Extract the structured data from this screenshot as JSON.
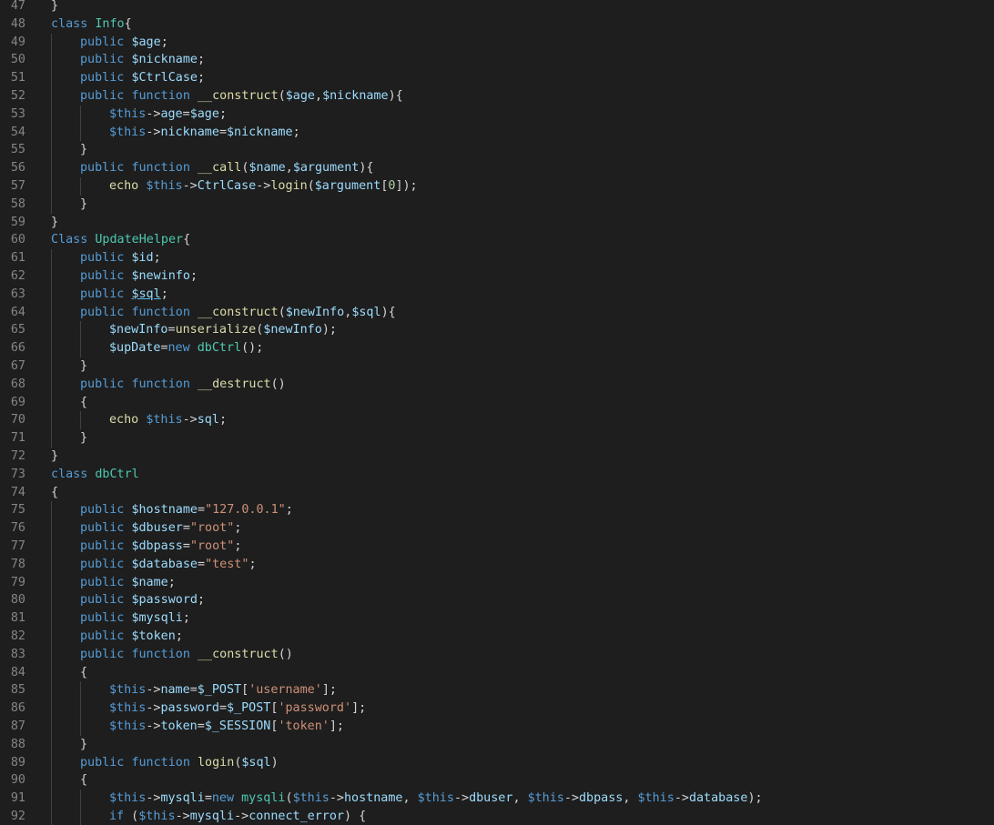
{
  "editor": {
    "theme_colors": {
      "background": "#1e1e1e",
      "line_number": "#858585",
      "keyword": "#569cd6",
      "variable": "#9cdcfe",
      "function": "#dcdcaa",
      "class": "#4ec9b0",
      "string": "#ce9178",
      "number": "#b5cea8",
      "text": "#d4d4d4"
    },
    "lines": [
      {
        "n": "47",
        "i": 0,
        "t": [
          [
            "}",
            "pn"
          ]
        ]
      },
      {
        "n": "48",
        "i": 0,
        "t": [
          [
            "class",
            "kw"
          ],
          [
            " ",
            "pn"
          ],
          [
            "Info",
            "cls"
          ],
          [
            "{",
            "pn"
          ]
        ]
      },
      {
        "n": "49",
        "i": 1,
        "t": [
          [
            "public",
            "kw"
          ],
          [
            " ",
            "pn"
          ],
          [
            "$age",
            "var"
          ],
          [
            ";",
            "pn"
          ]
        ]
      },
      {
        "n": "50",
        "i": 1,
        "t": [
          [
            "public",
            "kw"
          ],
          [
            " ",
            "pn"
          ],
          [
            "$nickname",
            "var"
          ],
          [
            ";",
            "pn"
          ]
        ]
      },
      {
        "n": "51",
        "i": 1,
        "t": [
          [
            "public",
            "kw"
          ],
          [
            " ",
            "pn"
          ],
          [
            "$CtrlCase",
            "var"
          ],
          [
            ";",
            "pn"
          ]
        ]
      },
      {
        "n": "52",
        "i": 1,
        "t": [
          [
            "public",
            "kw"
          ],
          [
            " ",
            "pn"
          ],
          [
            "function",
            "kw"
          ],
          [
            " ",
            "pn"
          ],
          [
            "__construct",
            "fn"
          ],
          [
            "(",
            "pn"
          ],
          [
            "$age",
            "var"
          ],
          [
            ",",
            "pn"
          ],
          [
            "$nickname",
            "var"
          ],
          [
            "){",
            "pn"
          ]
        ]
      },
      {
        "n": "53",
        "i": 2,
        "t": [
          [
            "$this",
            "this"
          ],
          [
            "->",
            "op"
          ],
          [
            "age",
            "var"
          ],
          [
            "=",
            "op"
          ],
          [
            "$age",
            "var"
          ],
          [
            ";",
            "pn"
          ]
        ]
      },
      {
        "n": "54",
        "i": 2,
        "t": [
          [
            "$this",
            "this"
          ],
          [
            "->",
            "op"
          ],
          [
            "nickname",
            "var"
          ],
          [
            "=",
            "op"
          ],
          [
            "$nickname",
            "var"
          ],
          [
            ";",
            "pn"
          ]
        ]
      },
      {
        "n": "55",
        "i": 1,
        "t": [
          [
            "}",
            "pn"
          ]
        ]
      },
      {
        "n": "56",
        "i": 1,
        "t": [
          [
            "public",
            "kw"
          ],
          [
            " ",
            "pn"
          ],
          [
            "function",
            "kw"
          ],
          [
            " ",
            "pn"
          ],
          [
            "__call",
            "fn"
          ],
          [
            "(",
            "pn"
          ],
          [
            "$name",
            "var"
          ],
          [
            ",",
            "pn"
          ],
          [
            "$argument",
            "var"
          ],
          [
            "){",
            "pn"
          ]
        ]
      },
      {
        "n": "57",
        "i": 2,
        "t": [
          [
            "echo",
            "fn"
          ],
          [
            " ",
            "pn"
          ],
          [
            "$this",
            "this"
          ],
          [
            "->",
            "op"
          ],
          [
            "CtrlCase",
            "var"
          ],
          [
            "->",
            "op"
          ],
          [
            "login",
            "fn"
          ],
          [
            "(",
            "pn"
          ],
          [
            "$argument",
            "var"
          ],
          [
            "[",
            "pn"
          ],
          [
            "0",
            "num"
          ],
          [
            "]);",
            "pn"
          ]
        ]
      },
      {
        "n": "58",
        "i": 1,
        "t": [
          [
            "}",
            "pn"
          ]
        ]
      },
      {
        "n": "59",
        "i": 0,
        "t": [
          [
            "}",
            "pn"
          ]
        ]
      },
      {
        "n": "60",
        "i": 0,
        "t": [
          [
            "Class",
            "kw"
          ],
          [
            " ",
            "pn"
          ],
          [
            "UpdateHelper",
            "cls"
          ],
          [
            "{",
            "pn"
          ]
        ]
      },
      {
        "n": "61",
        "i": 1,
        "t": [
          [
            "public",
            "kw"
          ],
          [
            " ",
            "pn"
          ],
          [
            "$id",
            "var"
          ],
          [
            ";",
            "pn"
          ]
        ]
      },
      {
        "n": "62",
        "i": 1,
        "t": [
          [
            "public",
            "kw"
          ],
          [
            " ",
            "pn"
          ],
          [
            "$newinfo",
            "var"
          ],
          [
            ";",
            "pn"
          ]
        ]
      },
      {
        "n": "63",
        "i": 1,
        "t": [
          [
            "public",
            "kw"
          ],
          [
            " ",
            "pn"
          ],
          [
            "$sql",
            "var ul"
          ],
          [
            ";",
            "pn"
          ]
        ]
      },
      {
        "n": "64",
        "i": 1,
        "t": [
          [
            "public",
            "kw"
          ],
          [
            " ",
            "pn"
          ],
          [
            "function",
            "kw"
          ],
          [
            " ",
            "pn"
          ],
          [
            "__construct",
            "fn"
          ],
          [
            "(",
            "pn"
          ],
          [
            "$newInfo",
            "var"
          ],
          [
            ",",
            "pn"
          ],
          [
            "$sql",
            "var"
          ],
          [
            "){",
            "pn"
          ]
        ]
      },
      {
        "n": "65",
        "i": 2,
        "t": [
          [
            "$newInfo",
            "var"
          ],
          [
            "=",
            "op"
          ],
          [
            "unserialize",
            "fn"
          ],
          [
            "(",
            "pn"
          ],
          [
            "$newInfo",
            "var"
          ],
          [
            ");",
            "pn"
          ]
        ]
      },
      {
        "n": "66",
        "i": 2,
        "t": [
          [
            "$upDate",
            "var"
          ],
          [
            "=",
            "op"
          ],
          [
            "new",
            "kw"
          ],
          [
            " ",
            "pn"
          ],
          [
            "dbCtrl",
            "cls"
          ],
          [
            "();",
            "pn"
          ]
        ]
      },
      {
        "n": "67",
        "i": 1,
        "t": [
          [
            "}",
            "pn"
          ]
        ]
      },
      {
        "n": "68",
        "i": 1,
        "t": [
          [
            "public",
            "kw"
          ],
          [
            " ",
            "pn"
          ],
          [
            "function",
            "kw"
          ],
          [
            " ",
            "pn"
          ],
          [
            "__destruct",
            "fn"
          ],
          [
            "()",
            "pn"
          ]
        ]
      },
      {
        "n": "69",
        "i": 1,
        "t": [
          [
            "{",
            "pn"
          ]
        ]
      },
      {
        "n": "70",
        "i": 2,
        "t": [
          [
            "echo",
            "fn"
          ],
          [
            " ",
            "pn"
          ],
          [
            "$this",
            "this"
          ],
          [
            "->",
            "op"
          ],
          [
            "sql",
            "var"
          ],
          [
            ";",
            "pn"
          ]
        ]
      },
      {
        "n": "71",
        "i": 1,
        "t": [
          [
            "}",
            "pn"
          ]
        ]
      },
      {
        "n": "72",
        "i": 0,
        "t": [
          [
            "}",
            "pn"
          ]
        ]
      },
      {
        "n": "73",
        "i": 0,
        "t": [
          [
            "class",
            "kw"
          ],
          [
            " ",
            "pn"
          ],
          [
            "dbCtrl",
            "cls"
          ]
        ]
      },
      {
        "n": "74",
        "i": 0,
        "t": [
          [
            "{",
            "pn"
          ]
        ]
      },
      {
        "n": "75",
        "i": 1,
        "t": [
          [
            "public",
            "kw"
          ],
          [
            " ",
            "pn"
          ],
          [
            "$hostname",
            "var"
          ],
          [
            "=",
            "op"
          ],
          [
            "\"127.0.0.1\"",
            "str"
          ],
          [
            ";",
            "pn"
          ]
        ]
      },
      {
        "n": "76",
        "i": 1,
        "t": [
          [
            "public",
            "kw"
          ],
          [
            " ",
            "pn"
          ],
          [
            "$dbuser",
            "var"
          ],
          [
            "=",
            "op"
          ],
          [
            "\"root\"",
            "str"
          ],
          [
            ";",
            "pn"
          ]
        ]
      },
      {
        "n": "77",
        "i": 1,
        "t": [
          [
            "public",
            "kw"
          ],
          [
            " ",
            "pn"
          ],
          [
            "$dbpass",
            "var"
          ],
          [
            "=",
            "op"
          ],
          [
            "\"root\"",
            "str"
          ],
          [
            ";",
            "pn"
          ]
        ]
      },
      {
        "n": "78",
        "i": 1,
        "t": [
          [
            "public",
            "kw"
          ],
          [
            " ",
            "pn"
          ],
          [
            "$database",
            "var"
          ],
          [
            "=",
            "op"
          ],
          [
            "\"test\"",
            "str"
          ],
          [
            ";",
            "pn"
          ]
        ]
      },
      {
        "n": "79",
        "i": 1,
        "t": [
          [
            "public",
            "kw"
          ],
          [
            " ",
            "pn"
          ],
          [
            "$name",
            "var"
          ],
          [
            ";",
            "pn"
          ]
        ]
      },
      {
        "n": "80",
        "i": 1,
        "t": [
          [
            "public",
            "kw"
          ],
          [
            " ",
            "pn"
          ],
          [
            "$password",
            "var"
          ],
          [
            ";",
            "pn"
          ]
        ]
      },
      {
        "n": "81",
        "i": 1,
        "t": [
          [
            "public",
            "kw"
          ],
          [
            " ",
            "pn"
          ],
          [
            "$mysqli",
            "var"
          ],
          [
            ";",
            "pn"
          ]
        ]
      },
      {
        "n": "82",
        "i": 1,
        "t": [
          [
            "public",
            "kw"
          ],
          [
            " ",
            "pn"
          ],
          [
            "$token",
            "var"
          ],
          [
            ";",
            "pn"
          ]
        ]
      },
      {
        "n": "83",
        "i": 1,
        "t": [
          [
            "public",
            "kw"
          ],
          [
            " ",
            "pn"
          ],
          [
            "function",
            "kw"
          ],
          [
            " ",
            "pn"
          ],
          [
            "__construct",
            "fn"
          ],
          [
            "()",
            "pn"
          ]
        ]
      },
      {
        "n": "84",
        "i": 1,
        "t": [
          [
            "{",
            "pn"
          ]
        ]
      },
      {
        "n": "85",
        "i": 2,
        "t": [
          [
            "$this",
            "this"
          ],
          [
            "->",
            "op"
          ],
          [
            "name",
            "var"
          ],
          [
            "=",
            "op"
          ],
          [
            "$_POST",
            "var"
          ],
          [
            "[",
            "pn"
          ],
          [
            "'username'",
            "str"
          ],
          [
            "];",
            "pn"
          ]
        ]
      },
      {
        "n": "86",
        "i": 2,
        "t": [
          [
            "$this",
            "this"
          ],
          [
            "->",
            "op"
          ],
          [
            "password",
            "var"
          ],
          [
            "=",
            "op"
          ],
          [
            "$_POST",
            "var"
          ],
          [
            "[",
            "pn"
          ],
          [
            "'password'",
            "str"
          ],
          [
            "];",
            "pn"
          ]
        ]
      },
      {
        "n": "87",
        "i": 2,
        "t": [
          [
            "$this",
            "this"
          ],
          [
            "->",
            "op"
          ],
          [
            "token",
            "var"
          ],
          [
            "=",
            "op"
          ],
          [
            "$_SESSION",
            "var"
          ],
          [
            "[",
            "pn"
          ],
          [
            "'token'",
            "str"
          ],
          [
            "];",
            "pn"
          ]
        ]
      },
      {
        "n": "88",
        "i": 1,
        "t": [
          [
            "}",
            "pn"
          ]
        ]
      },
      {
        "n": "89",
        "i": 1,
        "t": [
          [
            "public",
            "kw"
          ],
          [
            " ",
            "pn"
          ],
          [
            "function",
            "kw"
          ],
          [
            " ",
            "pn"
          ],
          [
            "login",
            "fn"
          ],
          [
            "(",
            "pn"
          ],
          [
            "$sql",
            "var"
          ],
          [
            ")",
            "pn"
          ]
        ]
      },
      {
        "n": "90",
        "i": 1,
        "t": [
          [
            "{",
            "pn"
          ]
        ]
      },
      {
        "n": "91",
        "i": 2,
        "t": [
          [
            "$this",
            "this"
          ],
          [
            "->",
            "op"
          ],
          [
            "mysqli",
            "var"
          ],
          [
            "=",
            "op"
          ],
          [
            "new",
            "kw"
          ],
          [
            " ",
            "pn"
          ],
          [
            "mysqli",
            "cls"
          ],
          [
            "(",
            "pn"
          ],
          [
            "$this",
            "this"
          ],
          [
            "->",
            "op"
          ],
          [
            "hostname",
            "var"
          ],
          [
            ", ",
            "pn"
          ],
          [
            "$this",
            "this"
          ],
          [
            "->",
            "op"
          ],
          [
            "dbuser",
            "var"
          ],
          [
            ", ",
            "pn"
          ],
          [
            "$this",
            "this"
          ],
          [
            "->",
            "op"
          ],
          [
            "dbpass",
            "var"
          ],
          [
            ", ",
            "pn"
          ],
          [
            "$this",
            "this"
          ],
          [
            "->",
            "op"
          ],
          [
            "database",
            "var"
          ],
          [
            ");",
            "pn"
          ]
        ]
      },
      {
        "n": "92",
        "i": 2,
        "t": [
          [
            "if",
            "kw"
          ],
          [
            " (",
            "pn"
          ],
          [
            "$this",
            "this"
          ],
          [
            "->",
            "op"
          ],
          [
            "mysqli",
            "var"
          ],
          [
            "->",
            "op"
          ],
          [
            "connect_error",
            "var"
          ],
          [
            ") {",
            "pn"
          ]
        ]
      }
    ]
  }
}
